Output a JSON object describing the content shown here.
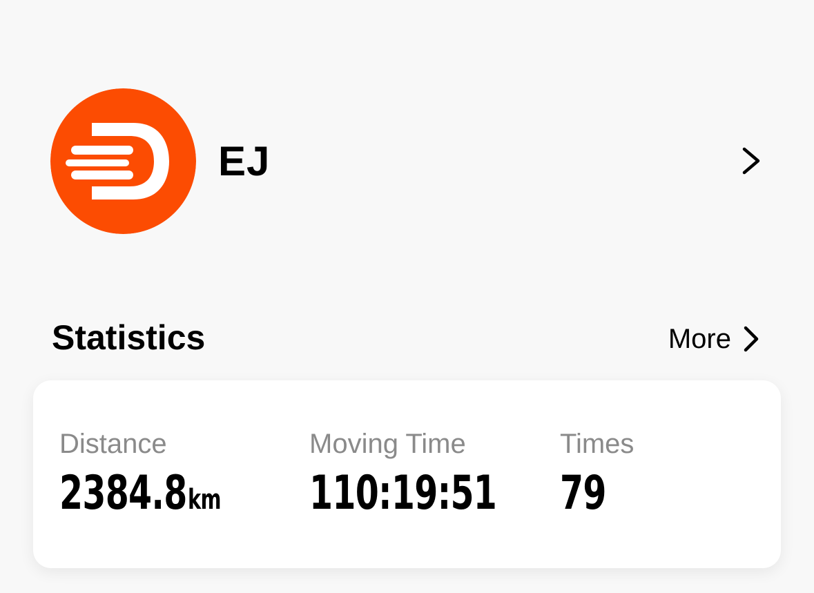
{
  "profile": {
    "name": "EJ",
    "avatar_icon": "brand-logo-icon",
    "avatar_color": "#fc4c02",
    "chevron_icon": "chevron-right-icon"
  },
  "statistics": {
    "title": "Statistics",
    "more_label": "More",
    "more_icon": "chevron-right-icon",
    "items": [
      {
        "label": "Distance",
        "value": "2384.8",
        "unit": "km"
      },
      {
        "label": "Moving Time",
        "value": "110:19:51",
        "unit": ""
      },
      {
        "label": "Times",
        "value": "79",
        "unit": ""
      }
    ]
  }
}
